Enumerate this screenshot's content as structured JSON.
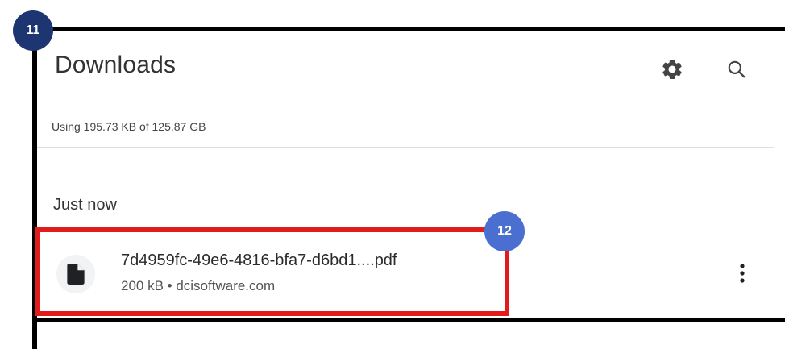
{
  "header": {
    "title": "Downloads",
    "settings_icon": "gear-icon",
    "search_icon": "search-icon"
  },
  "storage_text": "Using 195.73 KB of 125.87 GB",
  "sections": [
    {
      "label": "Just now",
      "items": [
        {
          "file_name": "7d4959fc-49e6-4816-bfa7-d6bd1....pdf",
          "meta": "200 kB • dcisoftware.com",
          "icon": "file-icon"
        }
      ]
    }
  ],
  "annotations": {
    "badge_a": "11",
    "badge_b": "12",
    "highlight_color": "#e21b1b",
    "badge_color": "#1d3570"
  }
}
